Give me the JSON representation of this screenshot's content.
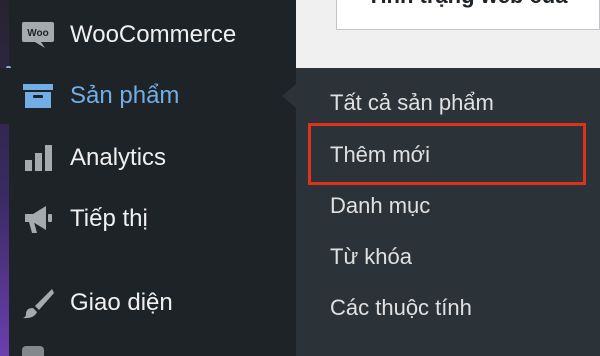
{
  "content": {
    "card_title": "Tình trạng web của"
  },
  "sidebar": {
    "items": [
      {
        "label": "WooCommerce",
        "icon": "woo-icon",
        "icon_text": "Woo"
      },
      {
        "label": "Sản phẩm",
        "icon": "archive-box-icon",
        "current": true
      },
      {
        "label": "Analytics",
        "icon": "bar-chart-icon"
      },
      {
        "label": "Tiếp thị",
        "icon": "megaphone-icon"
      },
      {
        "label": "Giao diện",
        "icon": "paintbrush-icon"
      }
    ]
  },
  "submenu": {
    "items": [
      {
        "label": "Tất cả sản phẩm"
      },
      {
        "label": "Thêm mới",
        "highlighted": true
      },
      {
        "label": "Danh mục"
      },
      {
        "label": "Từ khóa"
      },
      {
        "label": "Các thuộc tính"
      }
    ]
  },
  "colors": {
    "sidebar_bg": "#1d2327",
    "submenu_bg": "#2c3338",
    "current_text": "#72aee6",
    "highlight_border": "#e0321a"
  }
}
